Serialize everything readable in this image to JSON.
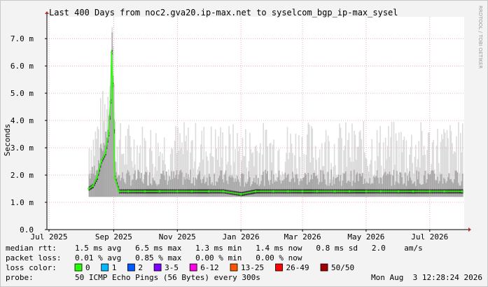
{
  "chart_data": {
    "type": "area",
    "title": "Last 400 Days from noc2.gva20.ip-max.net to syselcom_bgp_ip-max_sysel",
    "ylabel": "Seconds",
    "watermark": "RRDTOOL / TOBI OETIKER",
    "ylim": [
      0,
      0.0078
    ],
    "yticks": [
      {
        "value": 0,
        "label": "0.0"
      },
      {
        "value": 0.001,
        "label": "1.0 m"
      },
      {
        "value": 0.002,
        "label": "2.0 m"
      },
      {
        "value": 0.003,
        "label": "3.0 m"
      },
      {
        "value": 0.004,
        "label": "4.0 m"
      },
      {
        "value": 0.005,
        "label": "5.0 m"
      },
      {
        "value": 0.006,
        "label": "6.0 m"
      },
      {
        "value": 0.007,
        "label": "7.0 m"
      }
    ],
    "xlim": [
      "2025-06-29",
      "2026-08-03"
    ],
    "xticks": [
      {
        "date": "2025-07-01",
        "label": "Jul 2025"
      },
      {
        "date": "2025-09-01",
        "label": "Sep 2025"
      },
      {
        "date": "2025-11-01",
        "label": "Nov 2025"
      },
      {
        "date": "2026-01-01",
        "label": "Jan 2026"
      },
      {
        "date": "2026-03-01",
        "label": "Mar 2026"
      },
      {
        "date": "2026-05-01",
        "label": "May 2026"
      },
      {
        "date": "2026-07-01",
        "label": "Jul 2026"
      }
    ],
    "grid": true,
    "series": [
      {
        "name": "median rtt",
        "x": [
          "2025-08-08",
          "2025-08-12",
          "2025-08-16",
          "2025-08-20",
          "2025-08-24",
          "2025-08-27",
          "2025-08-29",
          "2025-08-30",
          "2025-08-31",
          "2025-09-02",
          "2025-09-06",
          "2025-09-15",
          "2025-10-01",
          "2025-10-15",
          "2025-11-01",
          "2025-11-15",
          "2025-12-01",
          "2025-12-15",
          "2026-01-01",
          "2026-01-15",
          "2026-02-01",
          "2026-02-15",
          "2026-03-01",
          "2026-03-15",
          "2026-04-01",
          "2026-04-15",
          "2026-05-01",
          "2026-05-15",
          "2026-06-01",
          "2026-06-15",
          "2026-07-01",
          "2026-07-15",
          "2026-08-01"
        ],
        "values": [
          0.0015,
          0.0016,
          0.0019,
          0.0025,
          0.0028,
          0.0035,
          0.0047,
          0.0065,
          0.0053,
          0.0019,
          0.0014,
          0.0014,
          0.0014,
          0.0014,
          0.0014,
          0.0014,
          0.0014,
          0.0014,
          0.0013,
          0.0014,
          0.0014,
          0.0014,
          0.0014,
          0.0014,
          0.0014,
          0.0014,
          0.0014,
          0.0014,
          0.0014,
          0.0014,
          0.0014,
          0.0014,
          0.0014
        ]
      }
    ],
    "legend": {
      "rows": [
        {
          "label": "median rtt:",
          "text": "1.5 ms avg   6.5 ms max   1.3 ms min   1.4 ms now   0.8 ms sd   2.0    am/s"
        },
        {
          "label": "packet loss:",
          "text": "0.01 % avg   0.85 % max   0.00 % min   0.00 % now"
        }
      ],
      "loss_color_label": "loss color:",
      "loss_colors": [
        {
          "label": "0",
          "color": "#26ff00"
        },
        {
          "label": "1",
          "color": "#00b8ff"
        },
        {
          "label": "2",
          "color": "#0059ff"
        },
        {
          "label": "3-5",
          "color": "#7e00ff"
        },
        {
          "label": "6-12",
          "color": "#ff00e4"
        },
        {
          "label": "13-25",
          "color": "#ff5500"
        },
        {
          "label": "26-49",
          "color": "#ff0000"
        },
        {
          "label": "50/50",
          "color": "#a10000"
        }
      ],
      "probe_label": "probe:",
      "probe_text": "50 ICMP Echo Pings (56 Bytes) every 300s",
      "timestamp": "Mon Aug  3 12:28:24 2026"
    }
  }
}
